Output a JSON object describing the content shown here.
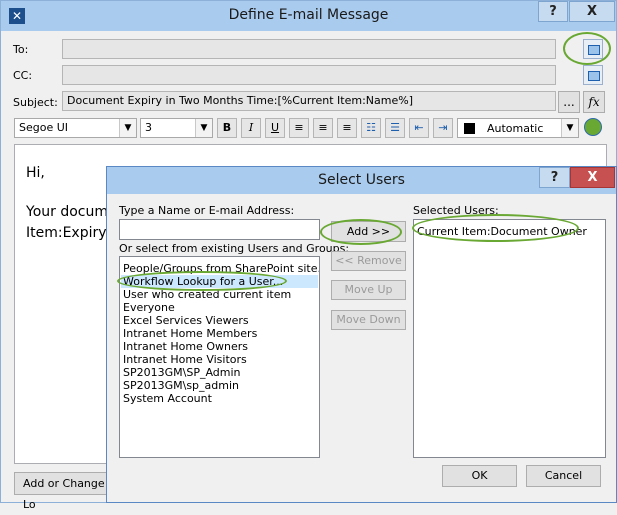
{
  "main": {
    "title": "Define E-mail Message",
    "help_label": "?",
    "close_label": "X",
    "to_label": "To:",
    "to_value": "",
    "cc_label": "CC:",
    "cc_value": "",
    "subject_label": "Subject:",
    "subject_value": "Document Expiry in Two Months Time:[%Current Item:Name%]",
    "ellipsis_label": "...",
    "fx_label": "fx",
    "font_name": "Segoe UI",
    "font_size": "3",
    "bold_label": "B",
    "italic_label": "I",
    "underline_label": "U",
    "color_label": "Automatic",
    "body_line1": "Hi,",
    "body_line2": "Your docum",
    "body_line3": "Item:Expiry",
    "add_lookup_label": "Add or Change Lo"
  },
  "dialog": {
    "title": "Select Users",
    "help_label": "?",
    "close_label": "X",
    "name_label": "Type a Name or E-mail Address:",
    "name_value": "",
    "existing_label": "Or select from existing Users and Groups:",
    "existing_items": [
      "People/Groups from SharePoint site...",
      "Workflow Lookup for a User...",
      "User who created current item",
      "Everyone",
      "Excel Services Viewers",
      "Intranet Home Members",
      "Intranet Home Owners",
      "Intranet Home Visitors",
      "SP2013GM\\SP_Admin",
      "SP2013GM\\sp_admin",
      "System Account"
    ],
    "add_label": "Add >>",
    "remove_label": "<< Remove",
    "move_up_label": "Move Up",
    "move_down_label": "Move Down",
    "selected_label": "Selected Users:",
    "selected_items": [
      "Current Item:Document Owner"
    ],
    "ok_label": "OK",
    "cancel_label": "Cancel"
  },
  "colors": {
    "title_bar": "#a9cbee",
    "highlight_ring": "#6aa834",
    "selection": "#cce8ff",
    "close": "#c75050"
  }
}
